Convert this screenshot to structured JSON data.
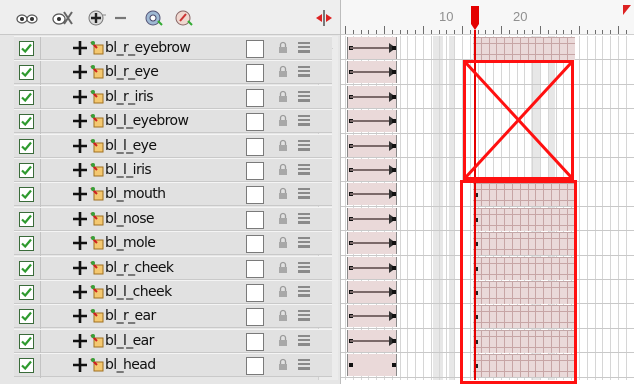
{
  "toolbar": {
    "buttons": [
      {
        "name": "show-all-icon"
      },
      {
        "name": "hide-all-icon"
      },
      {
        "name": "add-layer-icon"
      },
      {
        "name": "delete-layer-icon"
      },
      {
        "name": "add-peg-icon"
      },
      {
        "name": "add-drawing-icon"
      }
    ]
  },
  "layers": [
    {
      "label": "bl_r_eyebrow",
      "visible": true
    },
    {
      "label": "bl_r_eye",
      "visible": true
    },
    {
      "label": "bl_r_iris",
      "visible": true
    },
    {
      "label": "bl_l_eyebrow",
      "visible": true
    },
    {
      "label": "bl_l_eye",
      "visible": true
    },
    {
      "label": "bl_l_iris",
      "visible": true
    },
    {
      "label": "bl_mouth",
      "visible": true
    },
    {
      "label": "bl_nose",
      "visible": true
    },
    {
      "label": "bl_mole",
      "visible": true
    },
    {
      "label": "bl_r_cheek",
      "visible": true
    },
    {
      "label": "bl_l_cheek",
      "visible": true
    },
    {
      "label": "bl_r_ear",
      "visible": true
    },
    {
      "label": "bl_l_ear",
      "visible": true
    },
    {
      "label": "bl_head",
      "visible": true
    }
  ],
  "timeline": {
    "ruler_labels": [
      "10",
      "20"
    ],
    "current_frame": 13
  },
  "colors": {
    "highlight": "#ff1010",
    "playhead": "#e40000",
    "checkbox": "#2e9a2e",
    "cell_fill": "#ead9d9"
  }
}
